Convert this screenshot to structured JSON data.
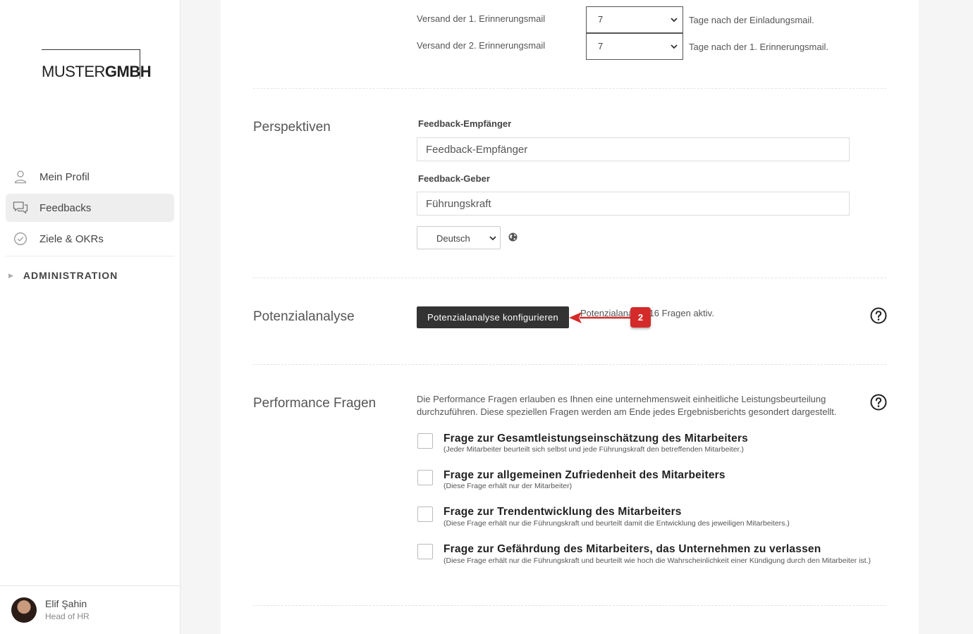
{
  "sidebar": {
    "logo": {
      "thin": "MUSTER",
      "bold": "GMBH"
    },
    "nav": [
      {
        "label": "Mein Profil",
        "icon": "user-icon"
      },
      {
        "label": "Feedbacks",
        "icon": "chat-icon",
        "active": true
      },
      {
        "label": "Ziele & OKRs",
        "icon": "check-circle-icon"
      }
    ],
    "admin": {
      "arrow": "▶",
      "label": "ADMINISTRATION"
    },
    "user": {
      "name": "Elif Şahin",
      "role": "Head of HR"
    }
  },
  "reminders": [
    {
      "label": "Versand der 1. Erinnerungsmail",
      "value": "7",
      "suffix": "Tage nach der Einladungsmail."
    },
    {
      "label": "Versand der 2. Erinnerungsmail",
      "value": "7",
      "suffix": "Tage nach der 1. Erinnerungsmail."
    }
  ],
  "perspektiven": {
    "title": "Perspektiven",
    "empfaenger_label": "Feedback-Empfänger",
    "empfaenger_value": "Feedback-Empfänger",
    "geber_label": "Feedback-Geber",
    "geber_value": "Führungskraft",
    "language": "Deutsch"
  },
  "potenzial": {
    "title": "Potenzialanalyse",
    "button": "Potenzialanalyse konfigurieren",
    "status_part1": "Potenzialana",
    "status_part2": " für 16 Fragen aktiv.",
    "annotation_number": "2"
  },
  "performance": {
    "title": "Performance Fragen",
    "description": "Die Performance Fragen erlauben es Ihnen eine unternehmensweit einheitliche Leistungsbeurteilung durchzuführen. Diese speziellen Fragen werden am Ende jedes Ergebnisberichts gesondert dargestellt.",
    "questions": [
      {
        "title": "Frage zur Gesamtleistungseinschätzung des Mitarbeiters",
        "sub": "(Jeder Mitarbeiter beurteilt sich selbst und jede Führungskraft den betreffenden Mitarbeiter.)"
      },
      {
        "title": "Frage zur allgemeinen Zufriedenheit des Mitarbeiters",
        "sub": "(Diese Frage erhält nur der Mitarbeiter)"
      },
      {
        "title": "Frage zur Trendentwicklung des Mitarbeiters",
        "sub": "(Diese Frage erhält nur die Führungskraft und beurteilt damit die Entwicklung des jeweiligen Mitarbeiters.)"
      },
      {
        "title": "Frage zur Gefährdung des Mitarbeiters, das Unternehmen zu verlassen",
        "sub": "(Diese Frage erhält nur die Führungskraft und beurteilt wie hoch die Wahrscheinlichkeit einer Kündigung durch den Mitarbeiter ist.)"
      }
    ]
  },
  "colors": {
    "annotation": "#d42a2a",
    "button_dark": "#333333"
  }
}
